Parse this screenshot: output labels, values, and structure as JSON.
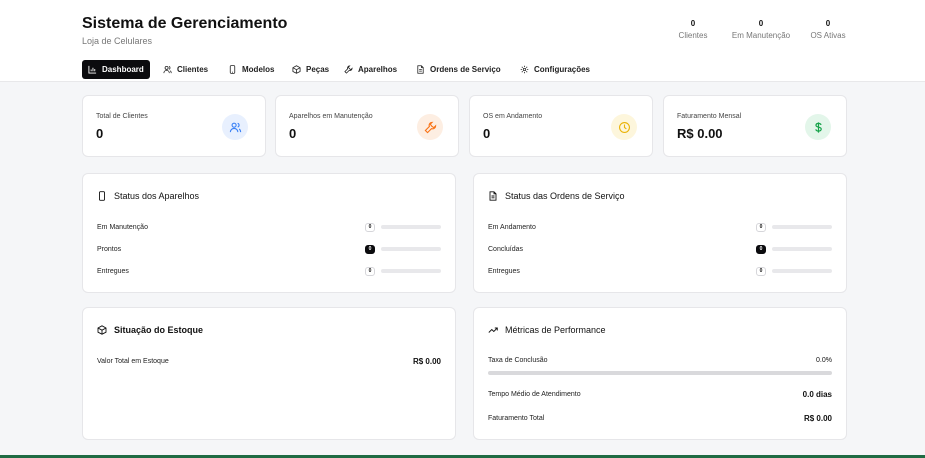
{
  "header": {
    "title": "Sistema de Gerenciamento",
    "subtitle": "Loja de Celulares",
    "stats": [
      {
        "value": "0",
        "label": "Clientes"
      },
      {
        "value": "0",
        "label": "Em Manutenção"
      },
      {
        "value": "0",
        "label": "OS Ativas"
      }
    ]
  },
  "nav": {
    "items": [
      {
        "label": "Dashboard",
        "icon": "chart-icon",
        "active": true
      },
      {
        "label": "Clientes",
        "icon": "users-icon"
      },
      {
        "label": "Modelos",
        "icon": "smartphone-icon"
      },
      {
        "label": "Peças",
        "icon": "package-icon"
      },
      {
        "label": "Aparelhos",
        "icon": "wrench-icon"
      },
      {
        "label": "Ordens de Serviço",
        "icon": "document-icon"
      },
      {
        "label": "Configurações",
        "icon": "gear-icon"
      }
    ]
  },
  "kpis": [
    {
      "label": "Total de Clientes",
      "value": "0",
      "icon": "users-icon",
      "color": "#3b82f6",
      "bg": "#e8f0fe"
    },
    {
      "label": "Aparelhos em Manutenção",
      "value": "0",
      "icon": "wrench-icon",
      "color": "#f97316",
      "bg": "#fdeee2"
    },
    {
      "label": "OS em Andamento",
      "value": "0",
      "icon": "clock-icon",
      "color": "#eab308",
      "bg": "#fdf6dc"
    },
    {
      "label": "Faturamento Mensal",
      "value": "R$ 0.00",
      "icon": "dollar-icon",
      "color": "#16a34a",
      "bg": "#e3f6ea"
    }
  ],
  "device_status": {
    "title": "Status dos Aparelhos",
    "icon": "smartphone-icon",
    "rows": [
      {
        "label": "Em Manutenção",
        "count": "0",
        "progress": 0,
        "dark": false
      },
      {
        "label": "Prontos",
        "count": "0",
        "progress": 0,
        "dark": true
      },
      {
        "label": "Entregues",
        "count": "0",
        "progress": 0,
        "dark": false
      }
    ]
  },
  "order_status": {
    "title": "Status das Ordens de Serviço",
    "icon": "document-icon",
    "rows": [
      {
        "label": "Em Andamento",
        "count": "0",
        "progress": 0,
        "dark": false
      },
      {
        "label": "Concluídas",
        "count": "0",
        "progress": 0,
        "dark": true
      },
      {
        "label": "Entregues",
        "count": "0",
        "progress": 0,
        "dark": false
      }
    ]
  },
  "stock": {
    "title": "Situação do Estoque",
    "icon": "package-icon",
    "label": "Valor Total em Estoque",
    "value": "R$ 0.00"
  },
  "performance": {
    "title": "Métricas de Performance",
    "icon": "trend-icon",
    "completion_label": "Taxa de Conclusão",
    "completion_value": "0.0%",
    "completion_progress": 0,
    "avg_time_label": "Tempo Médio de Atendimento",
    "avg_time_value": "0.0 dias",
    "revenue_label": "Faturamento Total",
    "revenue_value": "R$ 0.00"
  },
  "colors": {
    "accent": "#0b0b0e",
    "footer_bar": "#1f6b43"
  }
}
